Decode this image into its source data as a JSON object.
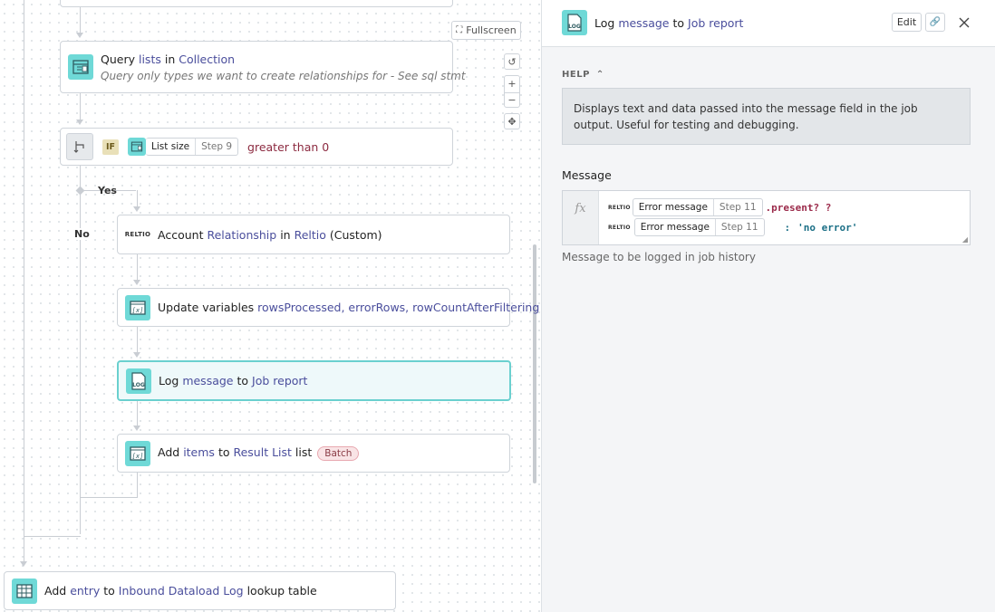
{
  "canvas": {
    "fullscreen_label": "Fullscreen",
    "branch_yes": "Yes",
    "branch_no": "No",
    "steps": {
      "query": {
        "prefix": "Query",
        "hl1": "lists",
        "mid": "in",
        "hl2": "Collection",
        "description": "Query only types we want to create relationships for - See sql stmt"
      },
      "if": {
        "badge": "IF",
        "pill_label": "List size",
        "pill_step": "Step 9",
        "operator": "greater than",
        "value": "0"
      },
      "account": {
        "prefix": "Account",
        "hl1": "Relationship",
        "mid": "in",
        "hl2": "Reltio",
        "suffix": "(Custom)",
        "logo": "RELTIO"
      },
      "update": {
        "prefix": "Update variables",
        "hl1": "rowsProcessed, errorRows, rowCountAfterFiltering"
      },
      "log": {
        "prefix": "Log",
        "hl1": "message",
        "mid": "to",
        "hl2": "Job report",
        "icon_text": "LOG"
      },
      "add_items": {
        "prefix": "Add",
        "hl1": "items",
        "mid": "to",
        "hl2": "Result List",
        "suffix": "list",
        "badge": "Batch"
      },
      "add_entry": {
        "prefix": "Add",
        "hl1": "entry",
        "mid": "to",
        "hl2": "Inbound Dataload Log",
        "suffix": "lookup table"
      }
    }
  },
  "panel": {
    "title_prefix": "Log",
    "title_hl1": "message",
    "title_mid": "to",
    "title_hl2": "Job report",
    "icon_text": "LOG",
    "edit_label": "Edit",
    "help_label": "HELP",
    "help_text": "Displays text and data passed into the message field in the job output. Useful for testing and debugging.",
    "message_label": "Message",
    "formula": {
      "line1_pill_label": "Error message",
      "line1_pill_step": "Step 11",
      "line1_code": ".present? ?",
      "line2_pill_label": "Error message",
      "line2_pill_step": "Step 11",
      "line2_code_colon": ":",
      "line2_code_string": "'no error'",
      "logo": "RELTIO"
    },
    "message_hint": "Message to be logged in job history"
  },
  "colors": {
    "accent_teal": "#6fd9d7",
    "link_purple": "#4a4e9c",
    "operator_red": "#9b2a4a"
  }
}
